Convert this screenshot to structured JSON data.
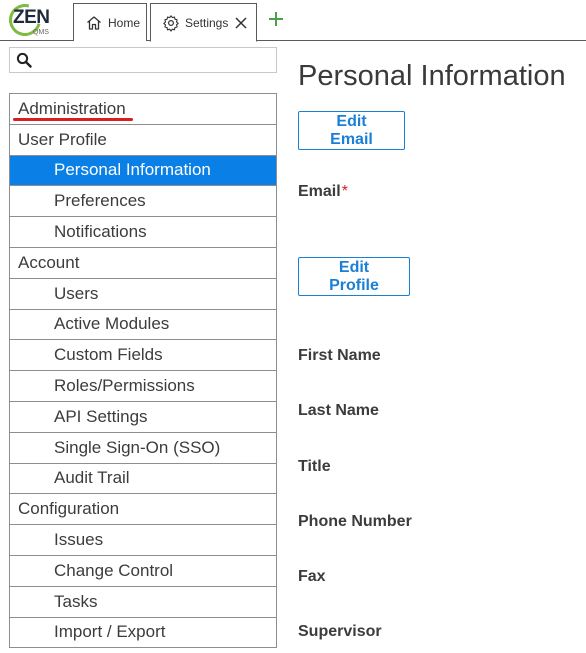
{
  "logo": {
    "text": "ZEN",
    "subtext": "QMS"
  },
  "tabs": {
    "home": {
      "label": "Home"
    },
    "settings": {
      "label": "Settings"
    }
  },
  "search": {
    "placeholder": "",
    "value": ""
  },
  "sidebar": {
    "items": [
      {
        "label": "Administration",
        "level": "section",
        "active": false
      },
      {
        "label": "User Profile",
        "level": "section",
        "active": false
      },
      {
        "label": "Personal Information",
        "level": "item",
        "active": true
      },
      {
        "label": "Preferences",
        "level": "item",
        "active": false
      },
      {
        "label": "Notifications",
        "level": "item",
        "active": false
      },
      {
        "label": "Account",
        "level": "section",
        "active": false
      },
      {
        "label": "Users",
        "level": "item",
        "active": false
      },
      {
        "label": "Active Modules",
        "level": "item",
        "active": false
      },
      {
        "label": "Custom Fields",
        "level": "item",
        "active": false
      },
      {
        "label": "Roles/Permissions",
        "level": "item",
        "active": false
      },
      {
        "label": "API Settings",
        "level": "item",
        "active": false
      },
      {
        "label": "Single Sign-On (SSO)",
        "level": "item",
        "active": false
      },
      {
        "label": "Audit Trail",
        "level": "item",
        "active": false
      },
      {
        "label": "Configuration",
        "level": "section",
        "active": false
      },
      {
        "label": "Issues",
        "level": "item",
        "active": false
      },
      {
        "label": "Change Control",
        "level": "item",
        "active": false
      },
      {
        "label": "Tasks",
        "level": "item",
        "active": false
      },
      {
        "label": "Import / Export",
        "level": "item",
        "active": false
      }
    ]
  },
  "main": {
    "title": "Personal Information",
    "edit_email_label": "Edit Email",
    "email_label": "Email",
    "required_marker": "*",
    "edit_profile_label": "Edit Profile",
    "fields": {
      "first_name": "First Name",
      "last_name": "Last Name",
      "title": "Title",
      "phone": "Phone Number",
      "fax": "Fax",
      "supervisor": "Supervisor"
    }
  },
  "colors": {
    "accent": "#0a7fe6",
    "button_text": "#1a7fd6",
    "required": "#d62020",
    "logo_green": "#7dbb42",
    "annotation_underline": "#d62020"
  },
  "icons": {
    "home_tab": "home-icon",
    "settings_tab": "gear-icon",
    "close_tab": "close-icon",
    "add_tab": "plus-icon",
    "search": "search-icon"
  }
}
